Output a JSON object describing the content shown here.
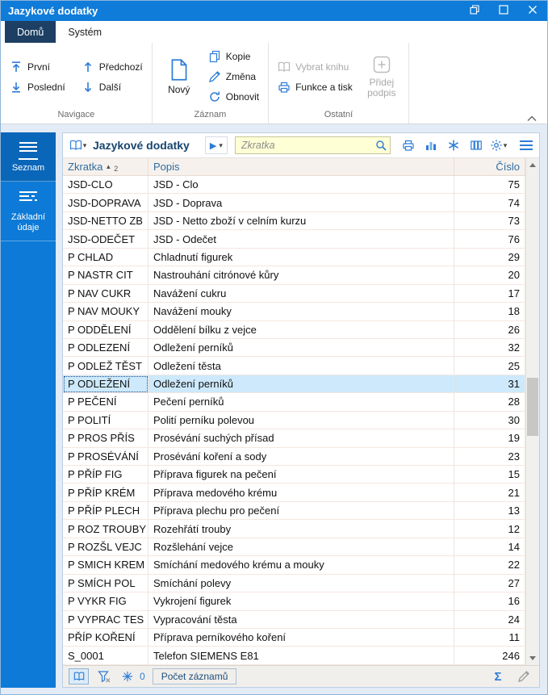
{
  "window": {
    "title": "Jazykové dodatky"
  },
  "icons": {
    "chevron_down": "▾",
    "play": "▶",
    "sum": "Σ"
  },
  "ribbon": {
    "tabs": {
      "home": "Domů",
      "system": "Systém"
    },
    "navigace": {
      "label": "Navigace",
      "first": "První",
      "prev": "Předchozí",
      "last": "Poslední",
      "next": "Další"
    },
    "zaznam": {
      "label": "Záznam",
      "new": "Nový",
      "copy": "Kopie",
      "edit": "Změna",
      "refresh": "Obnovit"
    },
    "ostatni": {
      "label": "Ostatní",
      "select_book": "Vybrat knihu",
      "functions_print": "Funkce a tisk",
      "add_signature": "Přidej podpis"
    }
  },
  "sidebar": {
    "items": [
      {
        "label": "Seznam",
        "active": true
      },
      {
        "label": "Základní údaje",
        "active": false
      }
    ]
  },
  "toolbar": {
    "title": "Jazykové dodatky",
    "search_placeholder": "Zkratka"
  },
  "table": {
    "columns": {
      "zkratka": "Zkratka",
      "popis": "Popis",
      "cislo": "Číslo"
    },
    "sort": {
      "arrow": "▲",
      "order": "2"
    },
    "rows": [
      {
        "zkratka": "JSD-CLO",
        "popis": "JSD - Clo",
        "cislo": 75
      },
      {
        "zkratka": "JSD-DOPRAVA",
        "popis": "JSD - Doprava",
        "cislo": 74
      },
      {
        "zkratka": "JSD-NETTO ZB",
        "popis": "JSD - Netto zboží v celním kurzu",
        "cislo": 73
      },
      {
        "zkratka": "JSD-ODEČET",
        "popis": "JSD - Odečet",
        "cislo": 76
      },
      {
        "zkratka": "P CHLAD",
        "popis": "Chladnutí figurek",
        "cislo": 29
      },
      {
        "zkratka": "P NASTR CIT",
        "popis": "Nastrouhání citrónové kůry",
        "cislo": 20
      },
      {
        "zkratka": "P NAV CUKR",
        "popis": "Navážení cukru",
        "cislo": 17
      },
      {
        "zkratka": "P NAV MOUKY",
        "popis": "Navážení mouky",
        "cislo": 18
      },
      {
        "zkratka": "P ODDĚLENÍ",
        "popis": "Oddělení bílku z vejce",
        "cislo": 26
      },
      {
        "zkratka": "P ODLEZENÍ",
        "popis": "Odležení perníků",
        "cislo": 32
      },
      {
        "zkratka": "P ODLEŽ TĚST",
        "popis": "Odležení těsta",
        "cislo": 25
      },
      {
        "zkratka": "P ODLEŽENÍ",
        "popis": "Odležení perníků",
        "cislo": 31,
        "selected": true
      },
      {
        "zkratka": "P PEČENÍ",
        "popis": "Pečení perníků",
        "cislo": 28
      },
      {
        "zkratka": "P POLITÍ",
        "popis": "Polití perníku polevou",
        "cislo": 30
      },
      {
        "zkratka": "P PROS PŘÍS",
        "popis": "Prosévání suchých přísad",
        "cislo": 19
      },
      {
        "zkratka": "P PROSÉVÁNÍ",
        "popis": "Prosévání koření a sody",
        "cislo": 23
      },
      {
        "zkratka": "P PŘÍP FIG",
        "popis": "Příprava figurek na pečení",
        "cislo": 15
      },
      {
        "zkratka": "P PŘÍP KRÉM",
        "popis": "Příprava medového krému",
        "cislo": 21
      },
      {
        "zkratka": "P PŘÍP PLECH",
        "popis": "Příprava plechu pro pečení",
        "cislo": 13
      },
      {
        "zkratka": "P ROZ TROUBY",
        "popis": "Rozehřátí trouby",
        "cislo": 12
      },
      {
        "zkratka": "P ROZŠL VEJC",
        "popis": "Rozšlehání vejce",
        "cislo": 14
      },
      {
        "zkratka": "P SMICH KREM",
        "popis": "Smíchání medového krému a mouky",
        "cislo": 22
      },
      {
        "zkratka": "P SMÍCH POL",
        "popis": "Smíchání polevy",
        "cislo": 27
      },
      {
        "zkratka": "P VYKR FIG",
        "popis": "Vykrojení figurek",
        "cislo": 16
      },
      {
        "zkratka": "P VYPRAC TES",
        "popis": "Vypracování těsta",
        "cislo": 24
      },
      {
        "zkratka": "PŘÍP KOŘENÍ",
        "popis": "Příprava perníkového koření",
        "cislo": 11
      },
      {
        "zkratka": "S_0001",
        "popis": "Telefon SIEMENS E81",
        "cislo": 246
      }
    ]
  },
  "statusbar": {
    "marker_count": "0",
    "records_button": "Počet záznamů"
  },
  "colors": {
    "accent": "#0f7cd9",
    "icon_blue": "#2e7cd6",
    "selection": "#cde9fb",
    "search_bg": "#ffffd6",
    "tab_active": "#1c3f63",
    "sidebar": "#0d7ad7"
  }
}
